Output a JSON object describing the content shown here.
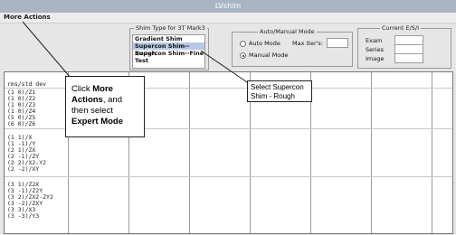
{
  "window": {
    "title": "LVshim"
  },
  "menu": {
    "more_actions": "More Actions"
  },
  "shim_type": {
    "legend": "Shim Type for 3T Mark3",
    "options": [
      "Gradient Shim",
      "Supercon Shim--Rough",
      "Supercon Shim--Fine",
      "Test"
    ],
    "selected_index": 1
  },
  "mode": {
    "legend": "Auto/Manual Mode",
    "auto_label": "Auto Mode",
    "manual_label": "Manual Mode",
    "max_iters_label": "Max Iter's:",
    "selected": "Manual Mode"
  },
  "current": {
    "legend": "Current E/S/I",
    "exam_label": "Exam",
    "series_label": "Series",
    "image_label": "Image"
  },
  "table": {
    "header": "rms/std dev",
    "rows": [
      "(1  0)/Z1",
      "(1  0)/Z2",
      "(1  0)/Z3",
      "(1  0)/Z4",
      "(5  0)/Z5",
      "(6  0)/Z6",
      "(1  1)/X",
      "(1 -1)/Y",
      "(2  1)/ZX",
      "(2 -1)/ZY",
      "(2  2)/X2-Y2",
      "(2 -2)/XY",
      "(3  1)/Z2X",
      "(3 -1)/Z2Y",
      "(3  2)/ZX2-ZY2",
      "(3 -2)/ZXY",
      "(3  3)/X3",
      "(3 -3)/Y3"
    ]
  },
  "callout_actions": {
    "l1_pre": "Click ",
    "l1_bold": "More",
    "l2_bold": "Actions",
    "l2_post": ", and",
    "l3": "then select",
    "l4_bold": "Expert Mode"
  },
  "callout_supercon": {
    "l1": "Select Supercon",
    "l2": "Shim - Rough"
  }
}
